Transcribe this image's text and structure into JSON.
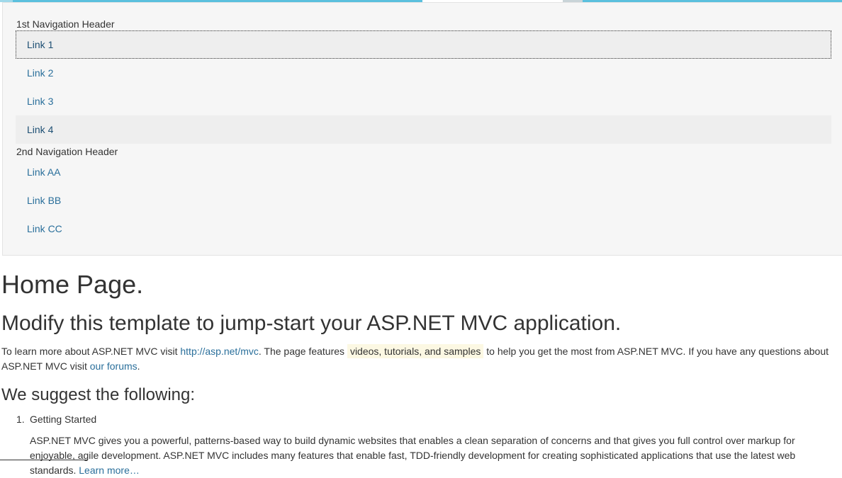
{
  "nav": {
    "header1": "1st Navigation Header",
    "links1": [
      "Link 1",
      "Link 2",
      "Link 3",
      "Link 4"
    ],
    "header2": "2nd Navigation Header",
    "links2": [
      "Link AA",
      "Link BB",
      "Link CC"
    ]
  },
  "main": {
    "title": "Home Page.",
    "subtitle": "Modify this template to jump-start your ASP.NET MVC application.",
    "intro": {
      "t1": "To learn more about ASP.NET MVC visit ",
      "link1": "http://asp.net/mvc",
      "t2": ". The page features ",
      "mark": "videos, tutorials, and samples",
      "t3": " to help you get the most from ASP.NET MVC. If you have any questions about ASP.NET MVC visit ",
      "link2": "our forums",
      "t4": "."
    },
    "suggest_heading": "We suggest the following:",
    "list": [
      {
        "num": "1.",
        "title": "Getting Started",
        "body": "ASP.NET MVC gives you a powerful, patterns-based way to build dynamic websites that enables a clean separation of concerns and that gives you full control over markup for enjoyable, agile development. ASP.NET MVC includes many features that enable fast, TDD-friendly development for creating sophisticated applications that use the latest web standards. ",
        "link": "Learn more…"
      }
    ]
  },
  "colors": {
    "accent": "#5bc0de",
    "link": "#2a6f9b",
    "panel": "#f6f6f6",
    "highlight": "#fcf8e3"
  }
}
